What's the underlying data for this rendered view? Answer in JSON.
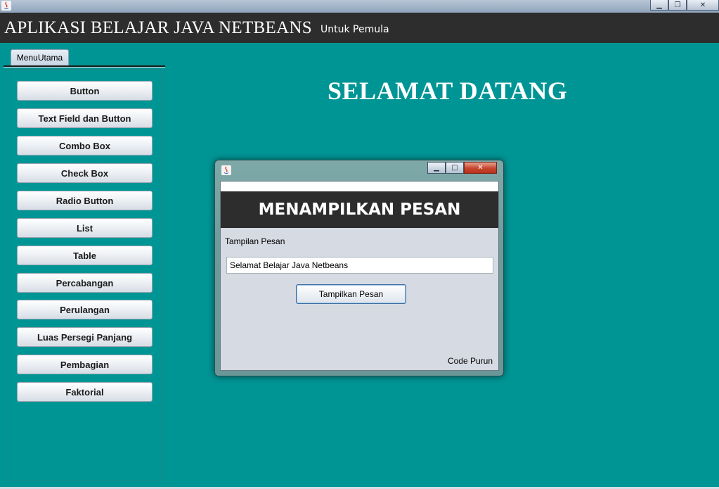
{
  "app": {
    "title": "APLIKASI BELAJAR JAVA NETBEANS",
    "subtitle": "Untuk Pemula"
  },
  "tabs": [
    {
      "label": "MenuUtama",
      "selected": true
    }
  ],
  "sidebar": {
    "items": [
      {
        "label": "Button"
      },
      {
        "label": "Text Field dan Button"
      },
      {
        "label": "Combo Box"
      },
      {
        "label": "Check Box"
      },
      {
        "label": "Radio Button"
      },
      {
        "label": "List"
      },
      {
        "label": "Table"
      },
      {
        "label": "Percabangan"
      },
      {
        "label": "Perulangan"
      },
      {
        "label": "Luas Persegi Panjang"
      },
      {
        "label": "Pembagian"
      },
      {
        "label": "Faktorial"
      }
    ]
  },
  "main": {
    "welcome": "SELAMAT DATANG"
  },
  "dialog": {
    "banner": "MENAMPILKAN PESAN",
    "field_label": "Tampilan Pesan",
    "input_value": "Selamat Belajar Java Netbeans",
    "button_label": "Tampilkan Pesan",
    "credit": "Code Purun"
  },
  "icons": {
    "window_icon": "java-icon",
    "minimize": "minimize-icon",
    "maximize": "maximize-icon",
    "close": "close-icon"
  },
  "colors": {
    "background": "#009595",
    "header": "#2d2d2d",
    "header_text": "#ffffff"
  }
}
